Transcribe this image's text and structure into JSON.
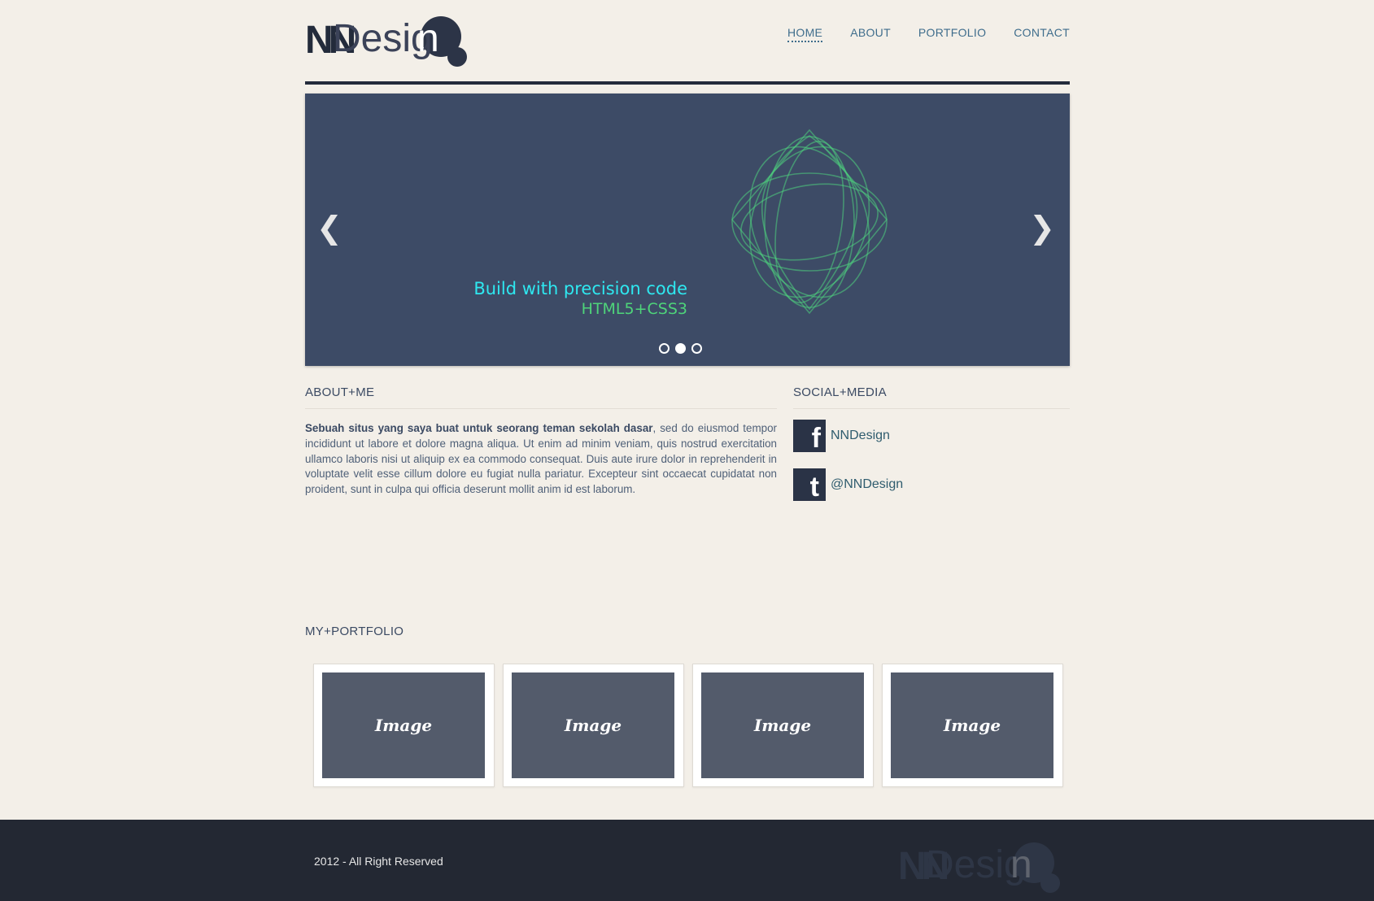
{
  "brand": {
    "logo_nn": "NN",
    "logo_design": "Desig",
    "logo_n": "n"
  },
  "nav": {
    "items": [
      {
        "label": "HOME",
        "active": true
      },
      {
        "label": "ABOUT",
        "active": false
      },
      {
        "label": "PORTFOLIO",
        "active": false
      },
      {
        "label": "CONTACT",
        "active": false
      }
    ]
  },
  "slider": {
    "line1": "Build with precision code",
    "line2": "HTML5+CSS3",
    "prev_icon": "chevron-left-icon",
    "next_icon": "chevron-right-icon",
    "dots": 3,
    "active_dot": 2,
    "colors": {
      "bg": "#3d4b66",
      "line1": "#2ee8f0",
      "line2": "#4ed47a"
    }
  },
  "about": {
    "title": "ABOUT+ME",
    "lead": "Sebuah situs yang saya buat untuk seorang teman sekolah dasar",
    "body": ", sed do eiusmod tempor incididunt ut labore et dolore magna aliqua. Ut enim ad minim veniam, quis nostrud exercitation ullamco laboris nisi ut aliquip ex ea commodo consequat. Duis aute irure dolor in reprehenderit in voluptate velit esse cillum dolore eu fugiat nulla pariatur. Excepteur sint occaecat cupidatat non proident, sunt in culpa qui officia deserunt mollit anim id est laborum."
  },
  "social": {
    "title": "SOCIAL+MEDIA",
    "items": [
      {
        "icon": "facebook-icon",
        "glyph": "f",
        "label": "NNDesign"
      },
      {
        "icon": "twitter-icon",
        "glyph": "t",
        "label": "@NNDesign"
      }
    ]
  },
  "portfolio": {
    "title": "MY+PORTFOLIO",
    "items": [
      {
        "label": "Image"
      },
      {
        "label": "Image"
      },
      {
        "label": "Image"
      },
      {
        "label": "Image"
      }
    ]
  },
  "footer": {
    "copyright": "2012 - All Right Reserved"
  }
}
